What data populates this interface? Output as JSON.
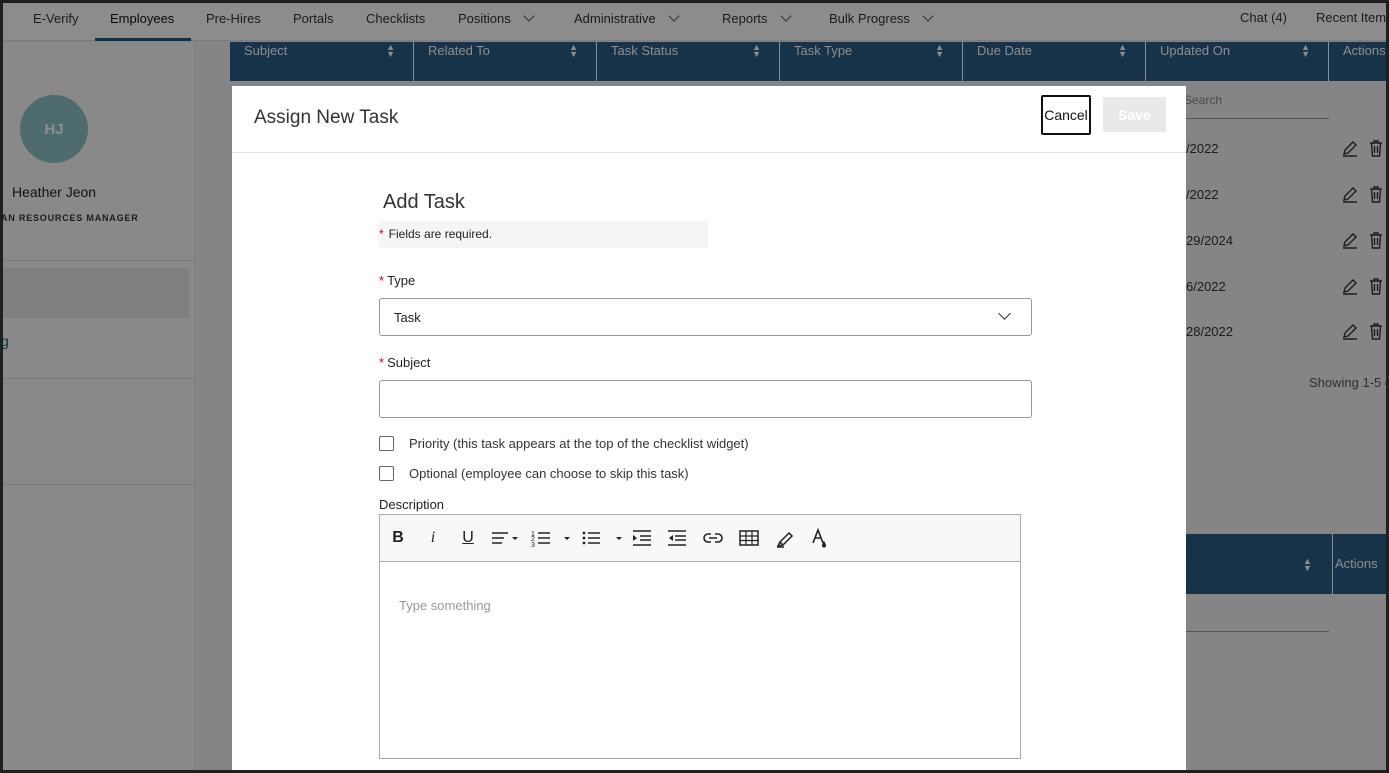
{
  "nav": {
    "items": [
      {
        "label": "E-Verify",
        "dropdown": false,
        "active": false
      },
      {
        "label": "Employees",
        "dropdown": false,
        "active": true
      },
      {
        "label": "Pre-Hires",
        "dropdown": false,
        "active": false
      },
      {
        "label": "Portals",
        "dropdown": false,
        "active": false
      },
      {
        "label": "Checklists",
        "dropdown": false,
        "active": false
      },
      {
        "label": "Positions",
        "dropdown": true,
        "active": false
      },
      {
        "label": "Administrative",
        "dropdown": true,
        "active": false
      },
      {
        "label": "Reports",
        "dropdown": true,
        "active": false
      },
      {
        "label": "Bulk Progress",
        "dropdown": true,
        "active": false
      }
    ],
    "chat": "Chat (4)",
    "recent": "Recent Item"
  },
  "profile": {
    "initials": "HJ",
    "name": "Heather Jeon",
    "title": "AN RESOURCES MANAGER",
    "link_fragment": "g"
  },
  "table": {
    "columns": [
      "Subject",
      "Related To",
      "Task Status",
      "Task Type",
      "Due Date",
      "Updated On",
      "Actions"
    ],
    "search_placeholder": "Search",
    "visible_dates": [
      "/2022",
      "/2022",
      "29/2024",
      "6/2022",
      "28/2022"
    ],
    "showing": "Showing 1-5 c",
    "second_table_actions": "Actions"
  },
  "modal": {
    "title": "Assign New Task",
    "cancel_label": "Cancel",
    "save_label": "Save",
    "form_title": "Add Task",
    "required_note": "Fields are required.",
    "required_star": "*",
    "type_label": "Type",
    "type_value": "Task",
    "subject_label": "Subject",
    "subject_value": "",
    "priority_label": "Priority (this task appears at the top of the checklist widget)",
    "optional_label": "Optional (employee can choose to skip this task)",
    "description_label": "Description",
    "description_placeholder": "Type something",
    "toolbar_icons": [
      "bold-icon",
      "italic-icon",
      "underline-icon",
      "align-icon",
      "ordered-list-icon",
      "bullet-list-icon",
      "indent-icon",
      "outdent-icon",
      "link-icon",
      "table-icon",
      "highlighter-icon",
      "text-color-icon"
    ]
  },
  "colors": {
    "table_header": "#2b5d88",
    "active_underline": "#1a5a85",
    "avatar": "#8fc4c9",
    "required_star": "#d0021b"
  }
}
